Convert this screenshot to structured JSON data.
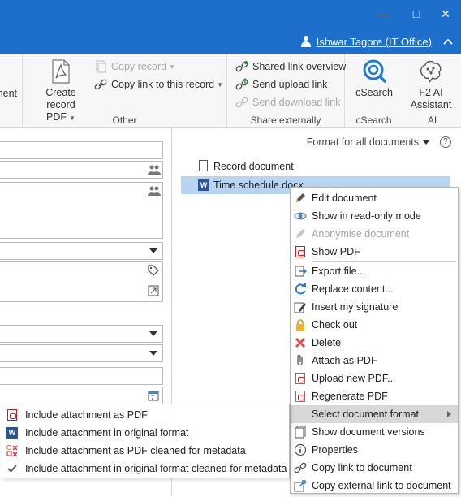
{
  "window": {
    "user_name": "Ishwar Tagore (IT Office)",
    "min_glyph": "—",
    "max_glyph": "□",
    "close_glyph": "✕",
    "collapse_glyph": "^"
  },
  "ribbon": {
    "partial_label": "ment",
    "create_pdf": {
      "line1": "Create",
      "line2": "record PDF"
    },
    "copy_record": "Copy record",
    "copy_link_record": "Copy link to this record",
    "other_label": "Other",
    "shared_link_overview": "Shared link overview",
    "send_upload_link": "Send upload link",
    "send_download_link": "Send download link",
    "share_externally_label": "Share externally",
    "csearch": "cSearch",
    "csearch_group_label": "cSearch",
    "ai_assistant": {
      "line1": "F2 AI",
      "line2": "Assistant"
    },
    "ai_group_label": "AI"
  },
  "docpane": {
    "format_label": "Format for all documents",
    "help_glyph": "?",
    "record_document": "Record document",
    "selected_document": "Time schedule.docx"
  },
  "context_menu": {
    "items": [
      {
        "label": "Edit document",
        "icon": "pencil-icon"
      },
      {
        "label": "Show in read-only mode",
        "icon": "eye-icon"
      },
      {
        "label": "Anonymise document",
        "icon": "pencil-icon",
        "disabled": true
      },
      {
        "label": "Show PDF",
        "icon": "pdf-icon"
      },
      {
        "label": "Export file...",
        "icon": "export-icon"
      },
      {
        "label": "Replace content...",
        "icon": "replace-icon"
      },
      {
        "label": "Insert my signature",
        "icon": "signature-icon"
      },
      {
        "label": "Check out",
        "icon": "lock-icon"
      },
      {
        "label": "Delete",
        "icon": "delete-icon"
      },
      {
        "label": "Attach as PDF",
        "icon": "paperclip-icon"
      },
      {
        "label": "Upload new PDF...",
        "icon": "pdf-upload-icon"
      },
      {
        "label": "Regenerate PDF",
        "icon": "pdf-regenerate-icon"
      },
      {
        "label": "Select document format",
        "icon": "none",
        "highlighted": true
      },
      {
        "label": "Show document versions",
        "icon": "versions-icon"
      },
      {
        "label": "Properties",
        "icon": "info-icon"
      },
      {
        "label": "Copy link to document",
        "icon": "link-icon"
      },
      {
        "label": "Copy external link to document",
        "icon": "external-link-icon"
      }
    ]
  },
  "sub_menu": {
    "items": [
      {
        "label": "Include attachment as PDF",
        "icon": "pdf-icon"
      },
      {
        "label": "Include attachment in original format",
        "icon": "word-icon"
      },
      {
        "label": "Include attachment as PDF cleaned for metadata",
        "icon": "pdf-clean-icon"
      },
      {
        "label": "Include attachment in original format cleaned for metadata",
        "icon": "checkmark-icon",
        "checked": true
      }
    ]
  },
  "colors": {
    "titlebar": "#1e6fcc",
    "selection": "#b9d4f2",
    "menu_highlight": "#d8d8d8",
    "disabled_text": "#a6a6a6"
  }
}
